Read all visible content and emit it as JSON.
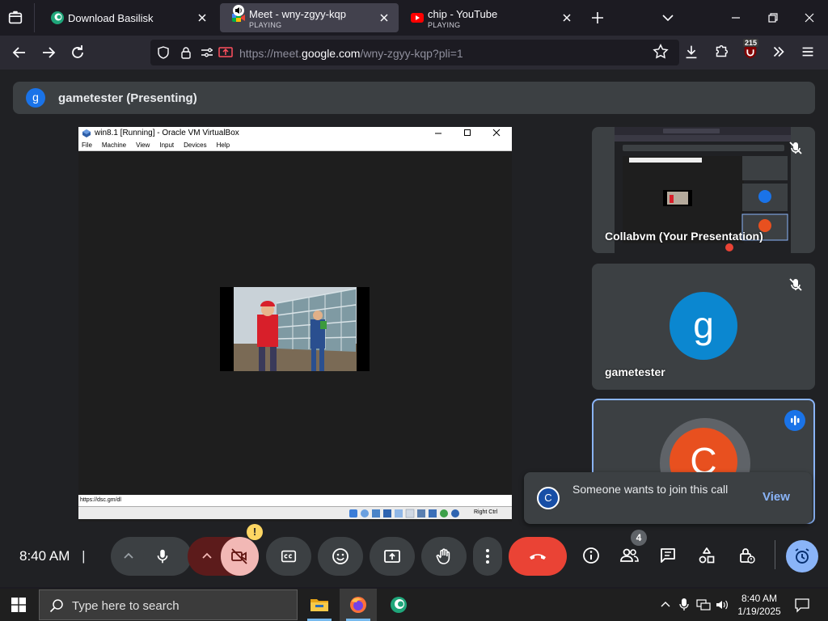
{
  "browser": {
    "tabs": [
      {
        "title": "Download Basilisk",
        "sub": ""
      },
      {
        "title": "Meet - wny-zgyy-kqp",
        "sub": "PLAYING"
      },
      {
        "title": "chip - YouTube",
        "sub": "PLAYING"
      }
    ],
    "url_prefix": "https://meet.",
    "url_domain": "google.com",
    "url_suffix": "/wny-zgyy-kqp?pli=1",
    "badge_count": "215"
  },
  "meet": {
    "presenter_initial": "g",
    "presenter_label": "gametester (Presenting)",
    "vm": {
      "title": "win8.1 [Running] - Oracle VM VirtualBox",
      "menu": [
        "File",
        "Machine",
        "View",
        "Input",
        "Devices",
        "Help"
      ],
      "status_url": "https://dsc.gm/dl",
      "host_key": "Right Ctrl"
    },
    "tiles": [
      {
        "name": "Collabvm (Your Presentation)"
      },
      {
        "name": "gametester",
        "initial": "g",
        "color": "#0b87d0"
      },
      {
        "name": "",
        "initial": "C",
        "color": "#e8501f"
      }
    ],
    "toast": {
      "initial": "C",
      "text": "Someone wants to join this call",
      "action": "View"
    },
    "clock": "8:40 AM",
    "clock_sep": "|",
    "people_count": "4",
    "warning_mark": "!"
  },
  "taskbar": {
    "search_placeholder": "Type here to search",
    "time": "8:40 AM",
    "date": "1/19/2025"
  },
  "colors": {
    "accent_blue": "#1a73e8",
    "end_call_red": "#ea4335",
    "cam_off": "#f2b8b5",
    "meet_bg": "#202124",
    "tile_bg": "#3c4043"
  }
}
